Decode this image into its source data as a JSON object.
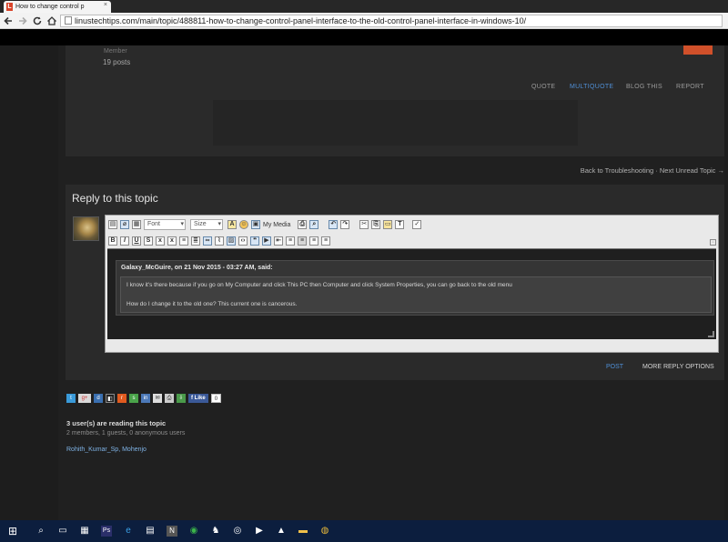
{
  "browser": {
    "tab_title": "How to change control p",
    "tab_close": "×",
    "url": "linustechtips.com/main/topic/488811-how-to-change-control-panel-interface-to-the-old-control-panel-interface-in-windows-10/",
    "back_icon": "back-arrow-icon",
    "forward_icon": "forward-arrow-icon",
    "reload_icon": "reload-icon",
    "home_icon": "home-icon"
  },
  "post": {
    "member_role": "Member",
    "post_count": "19 posts",
    "actions": [
      "QUOTE",
      "MULTIQUOTE",
      "BLOG THIS",
      "REPORT"
    ]
  },
  "nav": {
    "back_link": "Back to Troubleshooting · Next Unread Topic →"
  },
  "reply": {
    "title": "Reply to this topic",
    "font_select": "Font",
    "size_select": "Size",
    "my_media": "My Media",
    "quote_header": "Galaxy_McGuire, on 21 Nov 2015 - 03:27 AM, said:",
    "quote_line1": "I know it's there because if you go on My Computer and click This PC then Computer and click System Properties, you can go back to the old menu",
    "quote_line2": "How do I change it to the old one? This current one is cancerous.",
    "post_button": "POST",
    "more_options": "MORE REPLY OPTIONS"
  },
  "share": {
    "fb_like": "Like",
    "fb_count": "0"
  },
  "readers": {
    "heading": "3 user(s) are reading this topic",
    "summary": "2 members, 1 guests, 0 anonymous users",
    "names": "Rohith_Kumar_Sp, Mohenjo"
  },
  "colors": {
    "accent_blue": "#4f8fd6",
    "background": "#1b1b1b",
    "card": "#2a2a2a",
    "taskbar": "#0c1e3e"
  }
}
